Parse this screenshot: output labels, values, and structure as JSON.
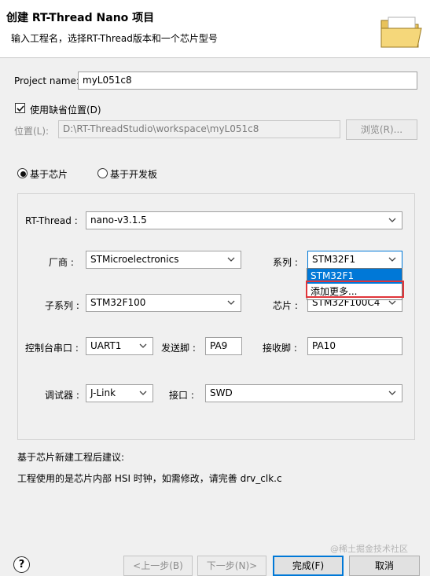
{
  "header": {
    "title": "创建 RT-Thread Nano 项目",
    "subtitle": "输入工程名，选择RT-Thread版本和一个芯片型号"
  },
  "project": {
    "name_label": "Project name:",
    "name_value": "myL051c8",
    "default_location_label": "使用缺省位置(D)",
    "default_location_checked": true,
    "location_label": "位置(L):",
    "location_value": "D:\\RT-ThreadStudio\\workspace\\myL051c8",
    "browse_label": "浏览(R)..."
  },
  "mode": {
    "chip_label": "基于芯片",
    "board_label": "基于开发板",
    "selected": "chip"
  },
  "config": {
    "rtthread_label": "RT-Thread :",
    "rtthread_value": "nano-v3.1.5",
    "vendor_label": "厂商 :",
    "vendor_value": "STMicroelectronics",
    "series_label": "系列 :",
    "series_value": "STM32F1",
    "series_options": [
      "STM32F1",
      "添加更多..."
    ],
    "subseries_label": "子系列 :",
    "subseries_value": "STM32F100",
    "chip_label": "芯片 :",
    "chip_value": "STM32F100C4",
    "console_label": "控制台串口 :",
    "console_value": "UART1",
    "tx_label": "发送脚 :",
    "tx_value": "PA9",
    "rx_label": "接收脚 :",
    "rx_value": "PA10",
    "debugger_label": "调试器 :",
    "debugger_value": "J-Link",
    "interface_label": "接口 :",
    "interface_value": "SWD"
  },
  "advice": {
    "title": "基于芯片新建工程后建议:",
    "text": "工程使用的是芯片内部 HSI 时钟，如需修改，请完善 drv_clk.c"
  },
  "buttons": {
    "help": "?",
    "back": "<上一步(B)",
    "next": "下一步(N)>",
    "finish": "完成(F)",
    "cancel": "取消"
  },
  "watermark": "@稀土掘金技术社区",
  "colors": {
    "accent": "#0078d7",
    "highlight_box": "#e0353a"
  }
}
